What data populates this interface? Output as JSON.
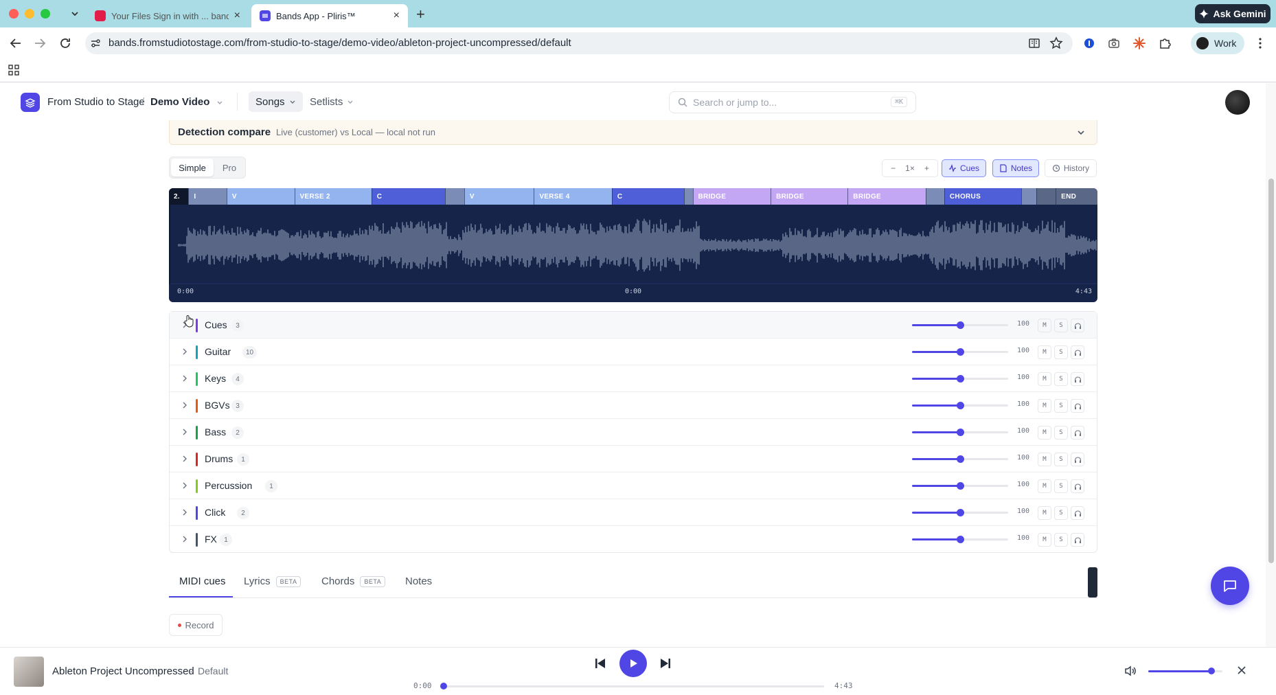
{
  "browser": {
    "tabs": [
      {
        "label": "Your Files Sign in with ... bands",
        "active": false
      },
      {
        "label": "Bands App - Pliris™",
        "active": true
      }
    ],
    "url": "bands.fromstudiotostage.com/from-studio-to-stage/demo-video/ableton-project-uncompressed/default",
    "gemini_label": "Ask Gemini",
    "profile_label": "Work"
  },
  "header": {
    "org": "From Studio to Stage",
    "separator": "/",
    "project": "Demo Video",
    "nav": [
      {
        "label": "Songs",
        "active": true
      },
      {
        "label": "Setlists",
        "active": false
      }
    ],
    "search_placeholder": "Search or jump to...",
    "search_shortcut": "⌘K"
  },
  "detection": {
    "title": "Detection compare",
    "subtitle": "Live (customer) vs Local — local not run"
  },
  "mode": {
    "options": [
      "Simple",
      "Pro"
    ],
    "selected": "Simple"
  },
  "controls": {
    "zoom_minus": "−",
    "zoom_value": "1×",
    "zoom_plus": "+",
    "cues_label": "Cues",
    "notes_label": "Notes",
    "history_label": "History"
  },
  "waveform": {
    "duration_seconds": 283,
    "time_start": "0:00",
    "time_mid": "0:00",
    "time_end": "4:43",
    "sections": [
      {
        "label": "2.",
        "start": 0.0,
        "end": 0.021,
        "color": "#0f172a"
      },
      {
        "label": "I",
        "start": 0.021,
        "end": 0.062,
        "color": "#7b8db6"
      },
      {
        "label": "V",
        "start": 0.062,
        "end": 0.135,
        "color": "#93b4ee"
      },
      {
        "label": "VERSE 2",
        "start": 0.135,
        "end": 0.218,
        "color": "#93b4ee"
      },
      {
        "label": "C",
        "start": 0.218,
        "end": 0.297,
        "color": "#4f5fd8"
      },
      {
        "label": "",
        "start": 0.297,
        "end": 0.318,
        "color": "#7b8db6"
      },
      {
        "label": "V",
        "start": 0.318,
        "end": 0.393,
        "color": "#93b4ee"
      },
      {
        "label": "VERSE 4",
        "start": 0.393,
        "end": 0.477,
        "color": "#93b4ee"
      },
      {
        "label": "C",
        "start": 0.477,
        "end": 0.555,
        "color": "#4f5fd8"
      },
      {
        "label": "",
        "start": 0.555,
        "end": 0.564,
        "color": "#7b8db6"
      },
      {
        "label": "BRIDGE",
        "start": 0.564,
        "end": 0.648,
        "color": "#c4a7f4"
      },
      {
        "label": "BRIDGE",
        "start": 0.648,
        "end": 0.731,
        "color": "#c4a7f4"
      },
      {
        "label": "BRIDGE",
        "start": 0.731,
        "end": 0.815,
        "color": "#c4a7f4"
      },
      {
        "label": "",
        "start": 0.815,
        "end": 0.835,
        "color": "#7b8db6"
      },
      {
        "label": "CHORUS",
        "start": 0.835,
        "end": 0.918,
        "color": "#4f5fd8"
      },
      {
        "label": "",
        "start": 0.918,
        "end": 0.934,
        "color": "#7b8db6"
      },
      {
        "label": "",
        "start": 0.934,
        "end": 0.955,
        "color": "#5b6787"
      },
      {
        "label": "END",
        "start": 0.955,
        "end": 1.0,
        "color": "#5b6787"
      }
    ]
  },
  "tracks": [
    {
      "name": "Cues",
      "count": "3",
      "color": "#7c3aed",
      "volume": "100",
      "level": 0.5
    },
    {
      "name": "Guitar",
      "count": "10",
      "color": "#0ea5b7",
      "volume": "100",
      "level": 0.5
    },
    {
      "name": "Keys",
      "count": "4",
      "color": "#22c55e",
      "volume": "100",
      "level": 0.5
    },
    {
      "name": "BGVs",
      "count": "3",
      "color": "#ea580c",
      "volume": "100",
      "level": 0.5
    },
    {
      "name": "Bass",
      "count": "2",
      "color": "#16a34a",
      "volume": "100",
      "level": 0.5
    },
    {
      "name": "Drums",
      "count": "1",
      "color": "#dc2626",
      "volume": "100",
      "level": 0.5
    },
    {
      "name": "Percussion",
      "count": "1",
      "color": "#84cc16",
      "volume": "100",
      "level": 0.5
    },
    {
      "name": "Click",
      "count": "2",
      "color": "#4f46e5",
      "volume": "100",
      "level": 0.5
    },
    {
      "name": "FX",
      "count": "1",
      "color": "#475569",
      "volume": "100",
      "level": 0.5
    }
  ],
  "track_buttons": {
    "mute": "M",
    "solo": "S"
  },
  "bottom_tabs": [
    {
      "label": "MIDI cues",
      "badge": "",
      "active": true
    },
    {
      "label": "Lyrics",
      "badge": "BETA",
      "active": false
    },
    {
      "label": "Chords",
      "badge": "BETA",
      "active": false
    },
    {
      "label": "Notes",
      "badge": "",
      "active": false
    }
  ],
  "record_label": "Record",
  "player": {
    "title": "Ableton Project Uncompressed",
    "separator": "·",
    "version": "Default",
    "time_current": "0:00",
    "time_total": "4:43",
    "progress": 0.0,
    "volume": 0.85
  },
  "colors": {
    "accent": "#4f46e5",
    "waveform_bg": "#17244a",
    "waveform_fg": "#7f8aa6"
  }
}
